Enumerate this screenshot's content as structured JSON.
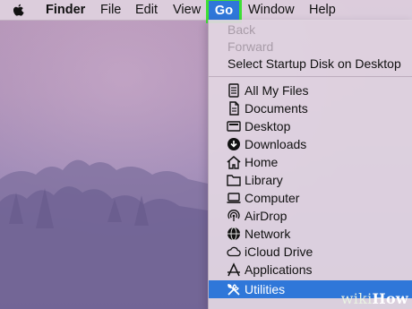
{
  "menubar": {
    "items": [
      "Finder",
      "File",
      "Edit",
      "View",
      "Go",
      "Window",
      "Help"
    ]
  },
  "go_menu": {
    "top_items": [
      {
        "label": "Back",
        "enabled": false
      },
      {
        "label": "Forward",
        "enabled": false
      },
      {
        "label": "Select Startup Disk on Desktop",
        "enabled": true
      }
    ],
    "places": [
      {
        "label": "All My Files",
        "icon": "all-my-files-icon"
      },
      {
        "label": "Documents",
        "icon": "documents-icon"
      },
      {
        "label": "Desktop",
        "icon": "desktop-icon"
      },
      {
        "label": "Downloads",
        "icon": "downloads-icon"
      },
      {
        "label": "Home",
        "icon": "home-icon"
      },
      {
        "label": "Library",
        "icon": "folder-icon"
      },
      {
        "label": "Computer",
        "icon": "computer-icon"
      },
      {
        "label": "AirDrop",
        "icon": "airdrop-icon"
      },
      {
        "label": "Network",
        "icon": "network-icon"
      },
      {
        "label": "iCloud Drive",
        "icon": "cloud-icon"
      },
      {
        "label": "Applications",
        "icon": "applications-icon"
      },
      {
        "label": "Utilities",
        "icon": "utilities-icon",
        "highlighted": true
      }
    ]
  },
  "colors": {
    "selection": "#2f77d9",
    "go_outline": "#3ee034"
  },
  "watermark": {
    "part1": "wiki",
    "part2": "How"
  }
}
